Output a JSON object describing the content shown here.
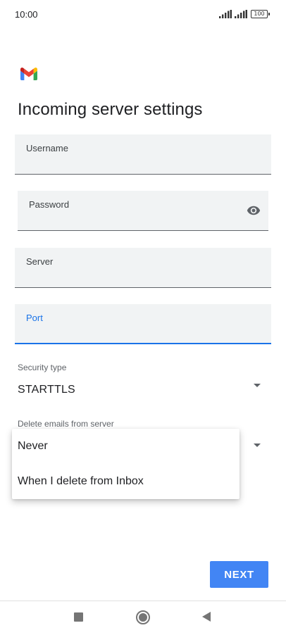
{
  "status_bar": {
    "time": "10:00",
    "battery": "100",
    "icons": [
      "signal-icon",
      "signal-icon",
      "battery-icon"
    ]
  },
  "app": {
    "logo": "gmail-logo-icon",
    "title": "Incoming server settings"
  },
  "form": {
    "username": {
      "label": "Username",
      "value": ""
    },
    "password": {
      "label": "Password",
      "value": "",
      "toggle_icon": "eye-icon"
    },
    "server": {
      "label": "Server",
      "value": ""
    },
    "port": {
      "label": "Port",
      "value": "",
      "focused": true
    },
    "security_type": {
      "label": "Security type",
      "value": "STARTTLS",
      "icon": "dropdown-arrow-icon"
    },
    "delete_emails": {
      "label": "Delete emails from server",
      "icon": "dropdown-arrow-icon",
      "options": [
        "Never",
        "When I delete from Inbox"
      ]
    }
  },
  "actions": {
    "next_label": "NEXT"
  },
  "nav_bar": {
    "icons": [
      "recents-square-icon",
      "home-circle-icon",
      "back-triangle-icon"
    ]
  },
  "colors": {
    "accent": "#1a73e8",
    "button": "#4285f4",
    "field_bg": "#f1f3f4"
  }
}
